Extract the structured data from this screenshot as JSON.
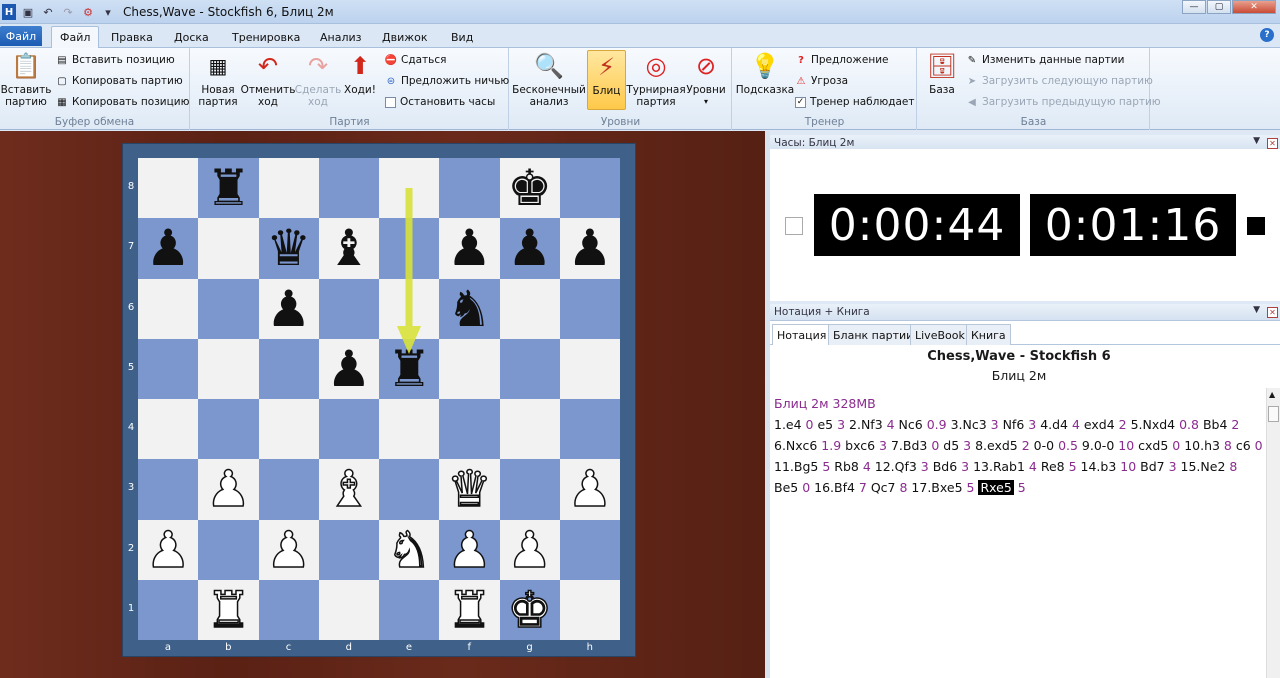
{
  "window": {
    "title": "Chess,Wave - Stockfish 6, Блиц 2м"
  },
  "menu": {
    "file": "Файл",
    "tabs": [
      "Файл",
      "Правка",
      "Доска",
      "Тренировка",
      "Анализ",
      "Движок",
      "Вид"
    ]
  },
  "ribbon": {
    "clipboard": {
      "paste": "Вставить\nпартию",
      "paste_position": "Вставить позицию",
      "copy_game": "Копировать партию",
      "copy_position": "Копировать позицию",
      "label": "Буфер обмена"
    },
    "game": {
      "new": "Новая\nпартия",
      "undo": "Отменить\nход",
      "redo": "Сделать\nход",
      "move": "Ходи!",
      "resign": "Сдаться",
      "offer_draw": "Предложить ничью",
      "stop_clock": "Остановить часы",
      "label": "Партия"
    },
    "levels": {
      "infinite": "Бесконечный\nанализ",
      "blitz": "Блиц",
      "tournament": "Турнирная\nпартия",
      "levels": "Уровни",
      "label": "Уровни"
    },
    "trainer": {
      "hint": "Подсказка",
      "suggestion": "Предложение",
      "threat": "Угроза",
      "watching": "Тренер наблюдает",
      "label": "Тренер"
    },
    "base": {
      "base": "База",
      "edit_data": "Изменить данные партии",
      "load_next": "Загрузить следующую партию",
      "load_prev": "Загрузить предыдущую партию",
      "label": "База"
    }
  },
  "board": {
    "files": [
      "a",
      "b",
      "c",
      "d",
      "e",
      "f",
      "g",
      "h"
    ],
    "ranks": [
      "8",
      "7",
      "6",
      "5",
      "4",
      "3",
      "2",
      "1"
    ],
    "position": [
      [
        "",
        "bR",
        "",
        "",
        "",
        "",
        "bK",
        ""
      ],
      [
        "bP",
        "",
        "bQ",
        "bB",
        "",
        "bP",
        "bP",
        "bP"
      ],
      [
        "",
        "",
        "bP",
        "",
        "",
        "bN",
        "",
        ""
      ],
      [
        "",
        "",
        "",
        "bP",
        "bR",
        "",
        "",
        ""
      ],
      [
        "",
        "",
        "",
        "",
        "",
        "",
        "",
        ""
      ],
      [
        "",
        "wP",
        "",
        "wB",
        "",
        "wQ",
        "",
        "wP"
      ],
      [
        "wP",
        "",
        "wP",
        "",
        "wN",
        "wP",
        "wP",
        ""
      ],
      [
        "",
        "wR",
        "",
        "",
        "",
        "wR",
        "wK",
        ""
      ]
    ],
    "arrow": {
      "from": "e8",
      "to": "e5",
      "color": "#d8e23a"
    }
  },
  "clock": {
    "header": "Часы: Блиц 2м",
    "white": "0:00:44",
    "black": "0:01:16"
  },
  "notation": {
    "header": "Нотация + Книга",
    "tabs": [
      "Нотация",
      "Бланк партии",
      "LiveBook",
      "Книга"
    ],
    "game_title": "Chess,Wave - Stockfish 6",
    "game_subtitle": "Блиц 2м",
    "engine_info": "Блиц 2м 328MB",
    "moves_text": [
      {
        "t": "1.e4 "
      },
      {
        "t": "0",
        "e": 1
      },
      {
        "t": " e5 "
      },
      {
        "t": "3",
        "e": 1
      },
      {
        "t": " 2.Nf3 "
      },
      {
        "t": "4",
        "e": 1
      },
      {
        "t": " Nc6 "
      },
      {
        "t": "0.9",
        "e": 1
      },
      {
        "t": " 3.Nc3 "
      },
      {
        "t": "3",
        "e": 1
      },
      {
        "t": " Nf6 "
      },
      {
        "t": "3",
        "e": 1
      },
      {
        "t": " 4.d4 "
      },
      {
        "t": "4",
        "e": 1
      },
      {
        "t": " exd4 "
      },
      {
        "t": "2",
        "e": 1
      },
      {
        "t": " 5.Nxd4 "
      },
      {
        "t": "0.8",
        "e": 1
      },
      {
        "t": " Bb4 "
      },
      {
        "t": "2",
        "e": 1
      },
      {
        "t": " 6.Nxc6 "
      },
      {
        "t": "1.9",
        "e": 1
      },
      {
        "t": " bxc6 "
      },
      {
        "t": "3",
        "e": 1
      },
      {
        "t": " 7.Bd3 "
      },
      {
        "t": "0",
        "e": 1
      },
      {
        "t": " d5 "
      },
      {
        "t": "3",
        "e": 1
      },
      {
        "t": " 8.exd5 "
      },
      {
        "t": "2",
        "e": 1
      },
      {
        "t": " 0-0 "
      },
      {
        "t": "0.5",
        "e": 1
      },
      {
        "t": " 9.0-0 "
      },
      {
        "t": "10",
        "e": 1
      },
      {
        "t": " cxd5 "
      },
      {
        "t": "0",
        "e": 1
      },
      {
        "t": " 10.h3 "
      },
      {
        "t": "8",
        "e": 1
      },
      {
        "t": " c6 "
      },
      {
        "t": "0",
        "e": 1
      },
      {
        "t": " 11.Bg5 "
      },
      {
        "t": "5",
        "e": 1
      },
      {
        "t": " Rb8 "
      },
      {
        "t": "4",
        "e": 1
      },
      {
        "t": " 12.Qf3 "
      },
      {
        "t": "3",
        "e": 1
      },
      {
        "t": " Bd6 "
      },
      {
        "t": "3",
        "e": 1
      },
      {
        "t": " 13.Rab1 "
      },
      {
        "t": "4",
        "e": 1
      },
      {
        "t": " Re8 "
      },
      {
        "t": "5",
        "e": 1
      },
      {
        "t": " 14.b3 "
      },
      {
        "t": "10",
        "e": 1
      },
      {
        "t": " Bd7 "
      },
      {
        "t": "3",
        "e": 1
      },
      {
        "t": " 15.Ne2 "
      },
      {
        "t": "8",
        "e": 1
      },
      {
        "t": " Be5 "
      },
      {
        "t": "0",
        "e": 1
      },
      {
        "t": " 16.Bf4 "
      },
      {
        "t": "7",
        "e": 1
      },
      {
        "t": " Qc7 "
      },
      {
        "t": "8",
        "e": 1
      },
      {
        "t": " 17.Bxe5 "
      },
      {
        "t": "5",
        "e": 1
      },
      {
        "t": " "
      },
      {
        "t": "Rxe5",
        "c": 1
      },
      {
        "t": " "
      },
      {
        "t": "5",
        "e": 1
      }
    ]
  }
}
